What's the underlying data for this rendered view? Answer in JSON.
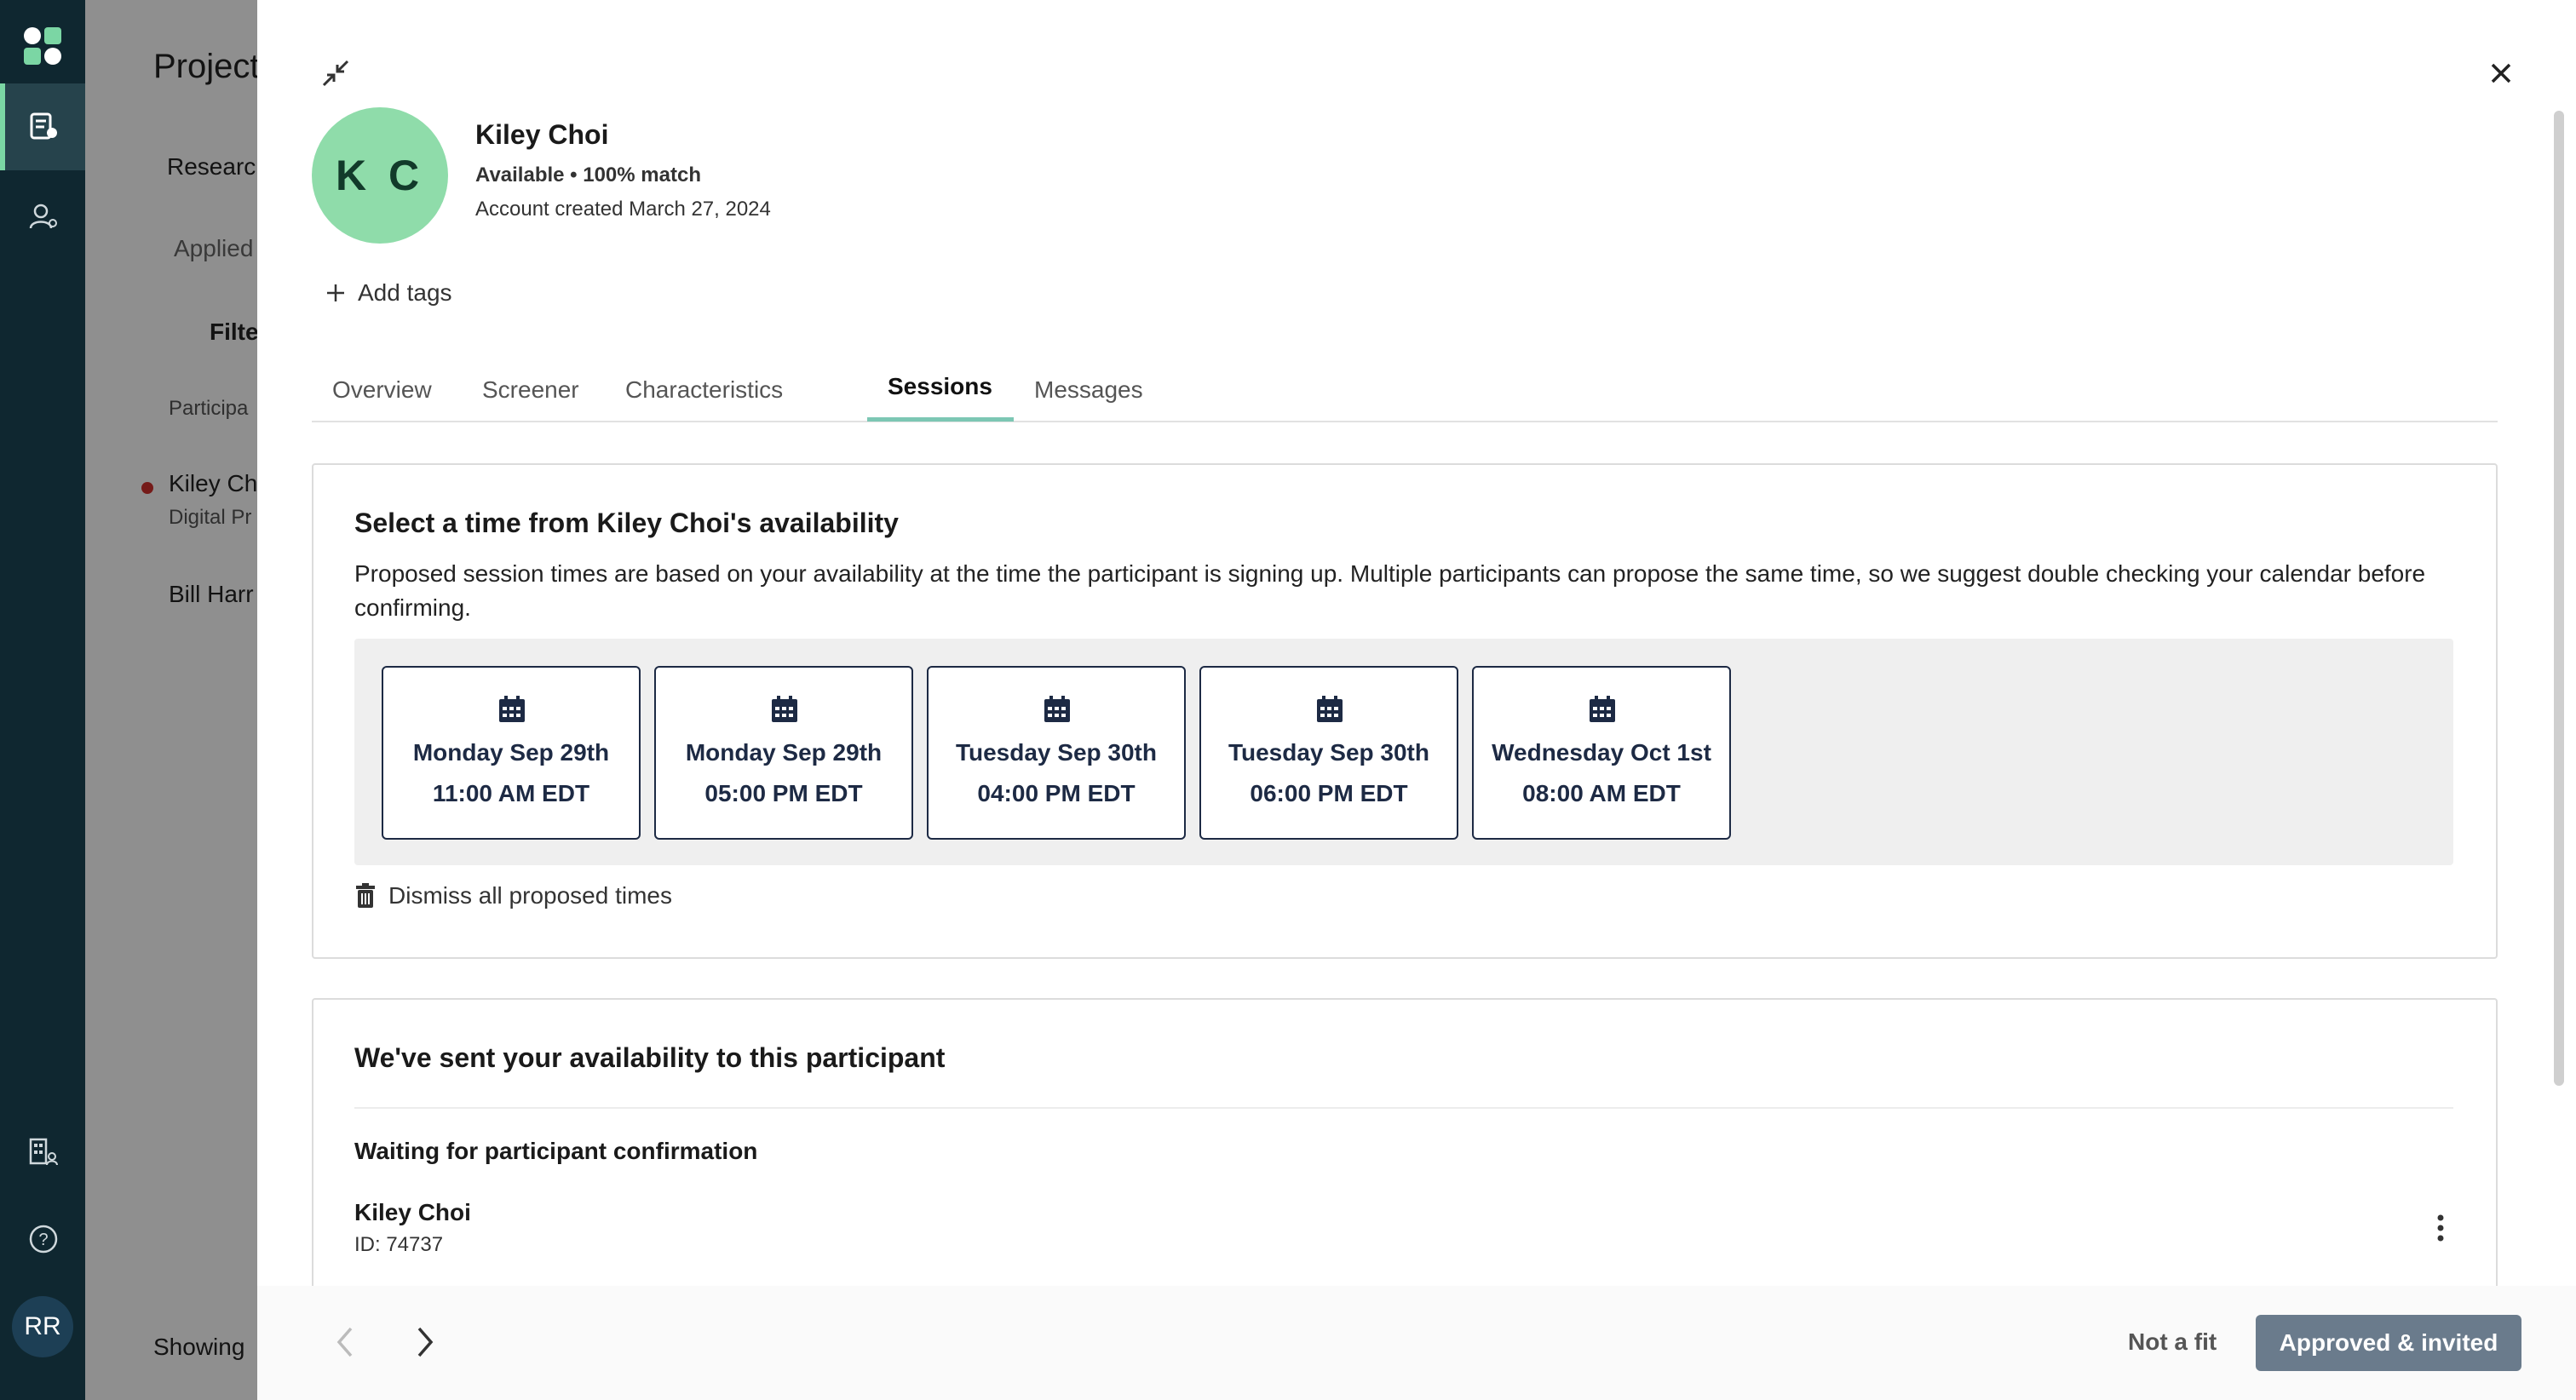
{
  "background_page": {
    "title": "Project",
    "tab": "Researc",
    "subtab": "Applied",
    "filter": "Filte",
    "column": "Participa",
    "rows": [
      {
        "name": "Kiley Ch",
        "sub": "Digital Pr"
      },
      {
        "name": "Bill Harr",
        "sub": ""
      }
    ],
    "footer": "Showing"
  },
  "rail": {
    "avatar_initials": "RR"
  },
  "participant": {
    "initials": "K C",
    "name": "Kiley Choi",
    "status": "Available • 100% match",
    "created": "Account created March 27, 2024",
    "add_tags": "Add tags"
  },
  "tabs": [
    "Overview",
    "Screener",
    "Characteristics",
    "Sessions",
    "Messages"
  ],
  "availability": {
    "title": "Select a time from Kiley Choi's availability",
    "description": "Proposed session times are based on your availability at the time the participant is signing up. Multiple participants can propose the same time, so we suggest double checking your calendar before confirming.",
    "slots": [
      {
        "date": "Monday Sep 29th",
        "time": "11:00 AM EDT"
      },
      {
        "date": "Monday Sep 29th",
        "time": "05:00 PM EDT"
      },
      {
        "date": "Tuesday Sep 30th",
        "time": "04:00 PM EDT"
      },
      {
        "date": "Tuesday Sep 30th",
        "time": "06:00 PM EDT"
      },
      {
        "date": "Wednesday Oct 1st",
        "time": "08:00 AM EDT"
      }
    ],
    "dismiss": "Dismiss all proposed times"
  },
  "sent": {
    "title": "We've sent your availability to this participant",
    "waiting": "Waiting for participant confirmation",
    "participant_name": "Kiley Choi",
    "participant_id": "ID: 74737"
  },
  "footer": {
    "not_fit": "Not a fit",
    "approve": "Approved & invited"
  }
}
